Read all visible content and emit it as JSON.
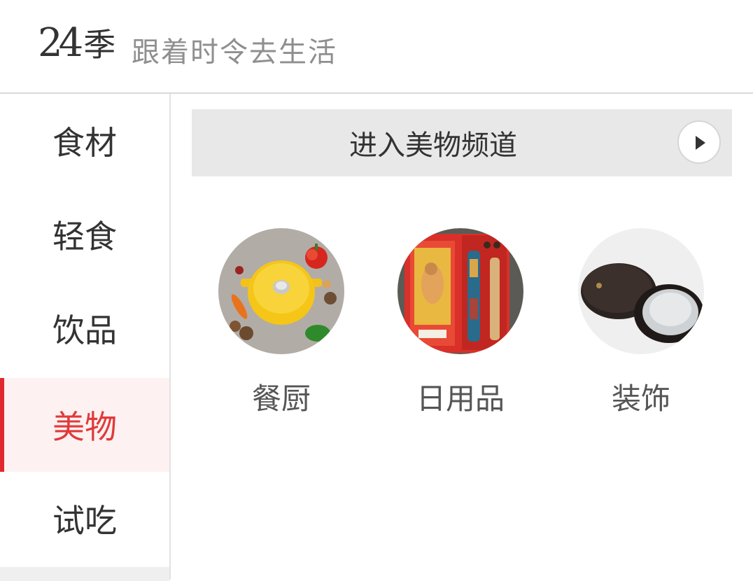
{
  "header": {
    "logo_number": "24",
    "logo_char": "季",
    "tagline": "跟着时令去生活"
  },
  "sidebar": {
    "items": [
      {
        "label": "食材",
        "active": false
      },
      {
        "label": "轻食",
        "active": false
      },
      {
        "label": "饮品",
        "active": false
      },
      {
        "label": "美物",
        "active": true
      },
      {
        "label": "试吃",
        "active": false
      }
    ]
  },
  "main": {
    "banner_label": "进入美物频道",
    "categories": [
      {
        "label": "餐厨",
        "image": "yellow-cast-iron-pot-with-vegetables"
      },
      {
        "label": "日用品",
        "image": "red-gift-box-with-pens"
      },
      {
        "label": "装饰",
        "image": "wooden-compact-mirror"
      }
    ]
  },
  "colors": {
    "accent": "#e0282e",
    "active_bg": "#fdf1f1",
    "banner_bg": "#e8e8e8",
    "tagline": "#8f8f8f"
  }
}
